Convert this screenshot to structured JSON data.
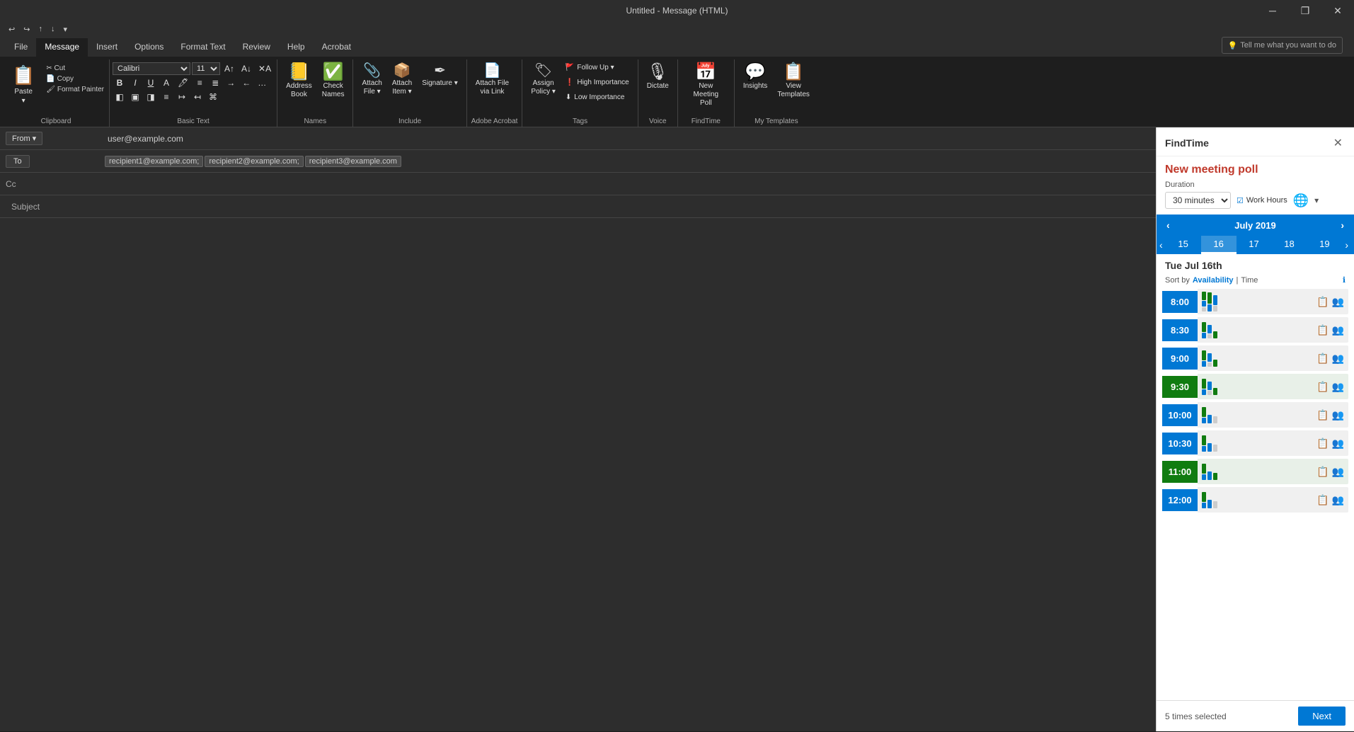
{
  "titlebar": {
    "title": "Untitled - Message (HTML)",
    "minimize": "─",
    "restore": "❐",
    "close": "✕"
  },
  "quickaccess": {
    "buttons": [
      "↩",
      "↪",
      "↑",
      "↓",
      "▾"
    ]
  },
  "ribbon_tabs": [
    {
      "label": "File",
      "active": false
    },
    {
      "label": "Message",
      "active": true
    },
    {
      "label": "Insert",
      "active": false
    },
    {
      "label": "Options",
      "active": false
    },
    {
      "label": "Format Text",
      "active": false
    },
    {
      "label": "Review",
      "active": false
    },
    {
      "label": "Help",
      "active": false
    },
    {
      "label": "Acrobat",
      "active": false
    }
  ],
  "tell_me": {
    "placeholder": "Tell me what you want to do",
    "icon": "💡"
  },
  "ribbon": {
    "clipboard": {
      "label": "Clipboard",
      "paste_label": "Paste",
      "cut_label": "Cut",
      "copy_label": "Copy",
      "format_painter_label": "Format Painter"
    },
    "basic_text": {
      "label": "Basic Text",
      "font": "Calibri",
      "font_size": "11",
      "bold": "B",
      "italic": "I",
      "underline": "U"
    },
    "names": {
      "label": "Names",
      "address_book": "Address\nBook",
      "check_names": "Check\nNames"
    },
    "include": {
      "label": "Include",
      "attach_file": "Attach\nFile",
      "attach_item": "Attach\nItem",
      "signature": "Signature"
    },
    "adobe_acrobat": {
      "label": "Adobe Acrobat",
      "attach_link": "Attach File\nvia Link"
    },
    "tags": {
      "label": "Tags",
      "assign_policy": "Assign\nPolicy",
      "follow_up": "Follow Up",
      "high_importance": "High Importance",
      "low_importance": "Low Importance"
    },
    "voice": {
      "label": "Voice",
      "dictate": "Dictate"
    },
    "findtime": {
      "label": "FindTime",
      "new_meeting_poll": "New\nMeeting Poll"
    },
    "my_templates": {
      "label": "My Templates",
      "insights": "Insights",
      "view_templates": "View\nTemplates"
    }
  },
  "compose": {
    "from_label": "From",
    "from_address": "user@example.com",
    "to_label": "To",
    "recipients": [
      "recipient1@example.com",
      "recipient2@example.com",
      "recipient3@example.com"
    ],
    "cc_label": "Cc",
    "subject_label": "Subject"
  },
  "findtime_panel": {
    "title": "FindTime",
    "close_label": "✕",
    "new_meeting_title": "New meeting poll",
    "duration_label": "Duration",
    "duration_value": "30 minutes",
    "work_hours_label": "Work Hours",
    "month_year": "July 2019",
    "dates": [
      {
        "date": "15",
        "active": false
      },
      {
        "date": "16",
        "active": true
      },
      {
        "date": "17",
        "active": false
      },
      {
        "date": "18",
        "active": false
      },
      {
        "date": "19",
        "active": false
      }
    ],
    "day_heading": "Tue Jul 16th",
    "sort_by_label": "Sort by",
    "sort_availability": "Availability",
    "sort_separator": "|",
    "sort_time": "Time",
    "time_slots": [
      {
        "time": "8:00",
        "color": "blue"
      },
      {
        "time": "8:30",
        "color": "blue"
      },
      {
        "time": "9:00",
        "color": "blue"
      },
      {
        "time": "9:30",
        "color": "green"
      },
      {
        "time": "10:00",
        "color": "blue"
      },
      {
        "time": "10:30",
        "color": "blue"
      },
      {
        "time": "11:00",
        "color": "green"
      },
      {
        "time": "12:00",
        "color": "blue"
      }
    ],
    "selected_count": "5 times selected",
    "next_label": "Next"
  }
}
